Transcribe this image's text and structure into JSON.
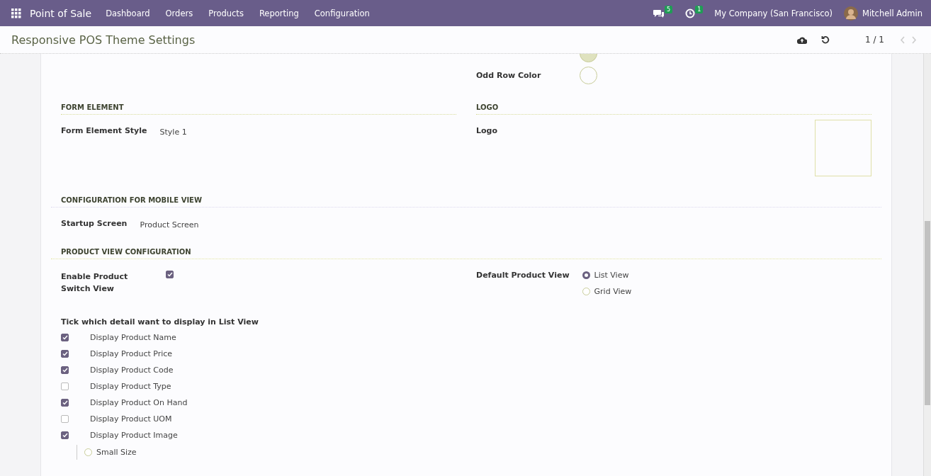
{
  "navbar": {
    "app_name": "Point of Sale",
    "menu": [
      "Dashboard",
      "Orders",
      "Products",
      "Reporting",
      "Configuration"
    ],
    "messages_badge": "5",
    "activities_badge": "1",
    "company": "My Company (San Francisco)",
    "user": "Mitchell Admin"
  },
  "control_panel": {
    "title": "Responsive POS Theme Settings",
    "pager": "1 / 1"
  },
  "partial_swatch": {
    "filled": true
  },
  "odd_row_color": {
    "label": "Odd Row Color",
    "filled": false
  },
  "form_element": {
    "heading": "FORM ELEMENT",
    "label": "Form Element Style",
    "value": "Style 1"
  },
  "logo": {
    "heading": "LOGO",
    "label": "Logo"
  },
  "mobile": {
    "heading": "CONFIGURATION FOR MOBILE VIEW",
    "label": "Startup Screen",
    "value": "Product Screen"
  },
  "product_view": {
    "heading": "PRODUCT VIEW CONFIGURATION",
    "switch_label": "Enable Product Switch View",
    "switch_checked": true,
    "default_label": "Default Product View",
    "options": [
      {
        "label": "List View",
        "selected": true
      },
      {
        "label": "Grid View",
        "selected": false
      }
    ]
  },
  "list_details": {
    "heading": "Tick which detail want to display in List View",
    "items": [
      {
        "label": "Display Product Name",
        "checked": true
      },
      {
        "label": "Display Product Price",
        "checked": true
      },
      {
        "label": "Display Product Code",
        "checked": true
      },
      {
        "label": "Display Product Type",
        "checked": false
      },
      {
        "label": "Display Product On Hand",
        "checked": true
      },
      {
        "label": "Display Product UOM",
        "checked": false
      },
      {
        "label": "Display Product Image",
        "checked": true
      }
    ],
    "image_sizes": [
      {
        "label": "Small Size",
        "selected": false
      }
    ]
  }
}
